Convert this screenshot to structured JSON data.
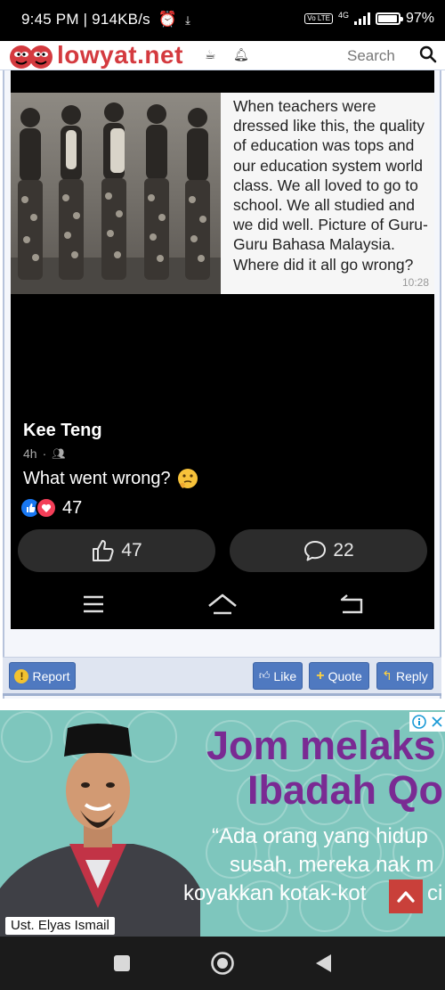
{
  "status_bar": {
    "time_speed": "9:45 PM | 914KB/s",
    "network": "4G",
    "volte": "Vo LTE",
    "battery": "97%"
  },
  "header": {
    "site_name": "lowyat.net",
    "search_label": "Search"
  },
  "post_screenshot": {
    "caption": "When teachers were dressed like this, the quality of education was tops and our education system world class. We all loved to go to school. We all studied and we did well. Picture of Guru-Guru Bahasa Malaysia. Where did it all go wrong?",
    "caption_time": "10:28",
    "poster_name": "Kee Teng",
    "post_age": "4h",
    "post_text": "What went wrong?",
    "reaction_count": "47",
    "like_button_count": "47",
    "comment_button_count": "22"
  },
  "actions": {
    "report": "Report",
    "like": "Like",
    "quote": "Quote",
    "reply": "Reply"
  },
  "ad": {
    "headline_1": "Jom melaks",
    "headline_2": "Ibadah Qo",
    "quote_line_1": "“Ada orang yang hidup",
    "quote_line_2": "susah, mereka nak m",
    "quote_line_3": "koyakkan kotak-kot",
    "quote_line_3_tail": "ci",
    "person_name": "Ust. Elyas Ismail"
  },
  "colors": {
    "brand_red": "#d43a3f",
    "button_blue": "#4f79c0",
    "ad_teal": "#7ec6bd",
    "ad_purple": "#7a2a93"
  }
}
